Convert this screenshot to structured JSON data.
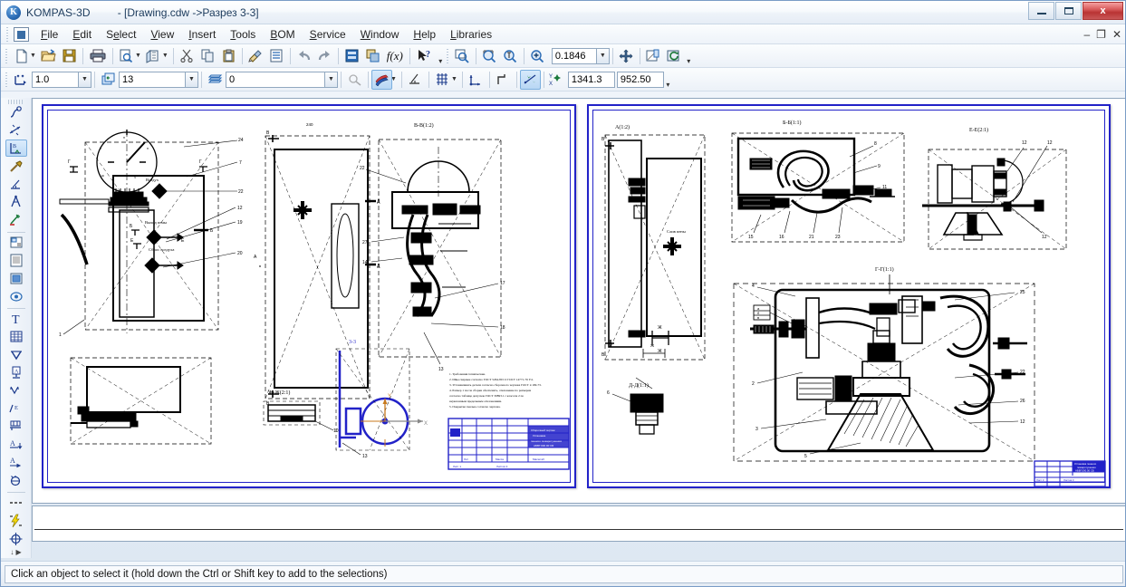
{
  "window": {
    "app_name": "KOMPAS-3D",
    "document_title": "- [Drawing.cdw ->Разрез 3-3]",
    "app_icon": "kompas-logo-icon",
    "controls": {
      "minimize": "minimize-icon",
      "maximize": "maximize-icon",
      "close": "x",
      "mdi_minimize": "–",
      "mdi_restore": "❐",
      "mdi_close": "✕"
    }
  },
  "menu": {
    "items": [
      {
        "label": "File"
      },
      {
        "label": "Edit"
      },
      {
        "label": "Select"
      },
      {
        "label": "View"
      },
      {
        "label": "Insert"
      },
      {
        "label": "Tools"
      },
      {
        "label": "BOM"
      },
      {
        "label": "Service"
      },
      {
        "label": "Window"
      },
      {
        "label": "Help"
      },
      {
        "label": "Libraries"
      }
    ]
  },
  "toolbar_main": {
    "buttons": [
      {
        "name": "new-document-button",
        "icon": "new-document-icon",
        "dropdown": true
      },
      {
        "name": "open-document-button",
        "icon": "open-folder-icon",
        "dropdown": false
      },
      {
        "name": "save-document-button",
        "icon": "floppy-save-icon",
        "dropdown": false
      },
      {
        "name": "print-button",
        "icon": "printer-icon",
        "dropdown": false
      },
      {
        "name": "print-preview-button",
        "icon": "print-preview-icon",
        "dropdown": true
      },
      {
        "name": "page-setup-button",
        "icon": "page-setup-icon",
        "dropdown": true
      },
      {
        "name": "cut-button",
        "icon": "scissors-icon",
        "dropdown": false
      },
      {
        "name": "copy-button",
        "icon": "copy-icon",
        "dropdown": false
      },
      {
        "name": "paste-button",
        "icon": "clipboard-paste-icon",
        "dropdown": false
      },
      {
        "name": "format-painter-button",
        "icon": "paintbrush-icon",
        "dropdown": false
      },
      {
        "name": "properties-button",
        "icon": "properties-list-icon",
        "dropdown": false
      },
      {
        "name": "undo-button",
        "icon": "undo-arrow-icon",
        "dropdown": false
      },
      {
        "name": "redo-button",
        "icon": "redo-arrow-icon",
        "dropdown": false
      },
      {
        "name": "library-manager-button",
        "icon": "library-icon",
        "dropdown": false
      },
      {
        "name": "model-tree-button",
        "icon": "model-tree-icon",
        "dropdown": false
      },
      {
        "name": "variables-button",
        "icon": "fx-function-icon",
        "dropdown": false
      },
      {
        "name": "context-help-button",
        "icon": "arrow-question-help-icon",
        "dropdown": false
      }
    ]
  },
  "toolbar_view": {
    "zoom_buttons": [
      {
        "name": "zoom-to-fit-button",
        "icon": "zoom-fit-icon"
      },
      {
        "name": "zoom-window-button",
        "icon": "zoom-window-icon"
      },
      {
        "name": "zoom-actual-button",
        "icon": "zoom-scale-icon"
      },
      {
        "name": "zoom-in-out-button",
        "icon": "zoom-in-icon"
      }
    ],
    "zoom_value": "0.1846",
    "pan_button": {
      "name": "pan-button",
      "icon": "pan-move-icon"
    },
    "redraw_button": {
      "name": "redraw-button",
      "icon": "redraw-icon"
    },
    "refresh_button": {
      "name": "refresh-view-button",
      "icon": "refresh-icon"
    }
  },
  "toolbar_current_state": {
    "style_icon": "curve-point-icon",
    "scale_value": "1.0",
    "layer_icon": "layers-stack-icon",
    "layer_value": "13",
    "line_style_icon": "line-style-icon",
    "line_style_value": "0",
    "restrictions_icon": "restrictions-icon",
    "line_color_icon": "line-style-red-blue-icon",
    "perpendicular_icon": "perpendicular-icon",
    "grid_icon": "grid-icon",
    "local_cs_icon": "local-coordinate-system-icon",
    "step_icon": "step-icon",
    "snap_icon": "snap-points-icon",
    "cursor_label_icon": "cursor-xy-icon",
    "cursor_x": "1341.3",
    "cursor_y": "952.50"
  },
  "tools_panel": {
    "groups": [
      {
        "items": [
          {
            "name": "geometry-tool",
            "icon": "geometry-curve-icon",
            "active": false
          },
          {
            "name": "dimensions-tool",
            "icon": "dimension-arrows-icon",
            "active": false
          },
          {
            "name": "designations-tool",
            "icon": "designations-icon",
            "active": true
          },
          {
            "name": "hatch-tool",
            "icon": "hatch-hammer-icon",
            "active": false
          },
          {
            "name": "parametric-tool",
            "icon": "parametric-perpendicular-icon",
            "active": false
          },
          {
            "name": "measure-tool",
            "icon": "compass-measure-icon",
            "active": false
          },
          {
            "name": "edit-tool",
            "icon": "edit-plus-minus-icon",
            "active": false
          }
        ]
      },
      {
        "items": [
          {
            "name": "insert-fragment-tool",
            "icon": "insert-fragment-icon",
            "active": false
          },
          {
            "name": "insert-view-tool",
            "icon": "insert-view-icon",
            "active": false
          },
          {
            "name": "insert-object-tool",
            "icon": "insert-object-icon",
            "active": false
          },
          {
            "name": "spec-object-tool",
            "icon": "spec-object-icon",
            "active": false
          }
        ]
      },
      {
        "items": [
          {
            "name": "text-tool",
            "icon": "text-t-icon",
            "active": false
          },
          {
            "name": "table-tool",
            "icon": "table-grid-icon",
            "active": false
          },
          {
            "name": "roughness-tool",
            "icon": "roughness-icon",
            "active": false
          },
          {
            "name": "base-tool",
            "icon": "datum-base-icon",
            "active": false
          },
          {
            "name": "leader-tool",
            "icon": "leader-line-icon",
            "active": false
          },
          {
            "name": "surface-marker-tool",
            "icon": "surface-marker-icon",
            "active": false
          },
          {
            "name": "position-line-tool",
            "icon": "position-line-icon",
            "active": false
          },
          {
            "name": "section-letter-tool",
            "icon": "section-letter-icon",
            "active": false
          },
          {
            "name": "arrow-view-tool",
            "icon": "arrow-view-icon",
            "active": false
          },
          {
            "name": "weld-seam-tool",
            "icon": "weld-seam-icon",
            "active": false
          }
        ]
      },
      {
        "items": [
          {
            "name": "dashed-line-tool",
            "icon": "dashed-line-icon",
            "active": false
          },
          {
            "name": "lightning-tool",
            "icon": "lightning-bolt-icon",
            "active": false
          },
          {
            "name": "axis-center-tool",
            "icon": "center-axis-icon",
            "active": false
          }
        ]
      }
    ],
    "scroll_hint": "↓ ▶"
  },
  "drawing": {
    "sheets": [
      {
        "name": "drawing-sheet-left"
      },
      {
        "name": "drawing-sheet-right"
      }
    ],
    "view_labels": [
      {
        "text": "В-В(1:2)",
        "sheet": "left"
      },
      {
        "text": "Ж-Ж(2:1)",
        "sheet": "left"
      },
      {
        "text": "3-3",
        "sheet": "left"
      },
      {
        "text": "А(1:2)",
        "sheet": "right"
      },
      {
        "text": "Б-Б(1:1)",
        "sheet": "right"
      },
      {
        "text": "Е-Е(2:1)",
        "sheet": "right"
      },
      {
        "text": "Г-Г(1:1)",
        "sheet": "right"
      },
      {
        "text": "Д-Д(1:1)",
        "sheet": "right"
      }
    ],
    "annotations": [
      {
        "text": "Воздух"
      },
      {
        "text": "Выход пены"
      },
      {
        "text": "Сброс воздуха"
      }
    ],
    "section_letters": [
      "Г",
      "Б",
      "В",
      "Е",
      "А",
      "Д",
      "Ж"
    ],
    "balloon_numbers": [
      "24",
      "7",
      "22",
      "12",
      "19",
      "20",
      "1",
      "27",
      "14",
      "17",
      "18",
      "13"
    ]
  },
  "properties_panel": {
    "name": "properties-bar",
    "content": ""
  },
  "statusbar": {
    "message": "Click an object to select it (hold down the Ctrl or Shift key to add to the selections)"
  },
  "colors": {
    "sheet_border": "#2222c8",
    "selection": "#2222c8",
    "accent": "#3a6ea5",
    "close_button": "#b93434",
    "drawing_ink": "#000000"
  }
}
